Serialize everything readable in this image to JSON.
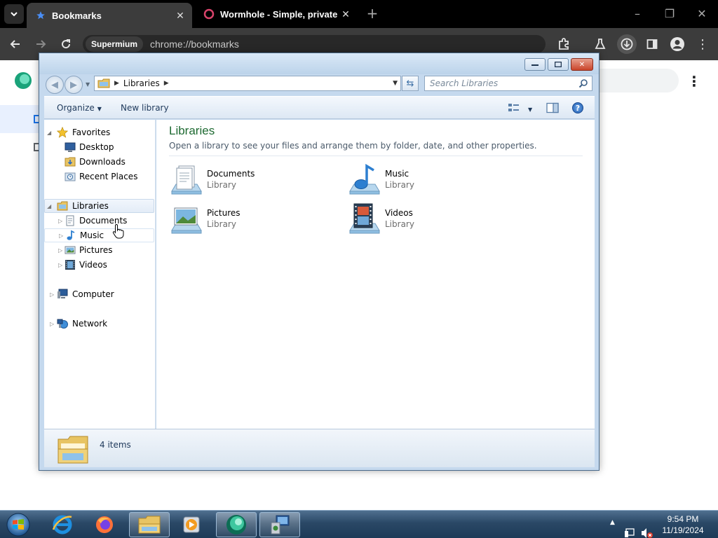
{
  "chrome": {
    "tabs": [
      {
        "title": "Bookmarks",
        "active": true
      },
      {
        "title": "Wormhole - Simple, private file",
        "active": false
      }
    ],
    "omnibox": {
      "chip": "Supermium",
      "url": "chrome://bookmarks"
    }
  },
  "explorer": {
    "address": {
      "crumb": "Libraries"
    },
    "search": {
      "placeholder": "Search Libraries"
    },
    "commands": {
      "organize": "Organize",
      "new_library": "New library"
    },
    "nav": {
      "favorites": "Favorites",
      "desktop": "Desktop",
      "downloads": "Downloads",
      "recent_places": "Recent Places",
      "libraries": "Libraries",
      "documents": "Documents",
      "music": "Music",
      "pictures": "Pictures",
      "videos": "Videos",
      "computer": "Computer",
      "network": "Network"
    },
    "content": {
      "heading": "Libraries",
      "subtitle": "Open a library to see your files and arrange them by folder, date, and other properties.",
      "items": [
        {
          "name": "Documents",
          "type": "Library"
        },
        {
          "name": "Music",
          "type": "Library"
        },
        {
          "name": "Pictures",
          "type": "Library"
        },
        {
          "name": "Videos",
          "type": "Library"
        }
      ]
    },
    "details": {
      "count": "4 items"
    }
  },
  "taskbar": {
    "clock": {
      "time": "9:54 PM",
      "date": "11/19/2024"
    }
  },
  "colors": {
    "heading_green": "#1e6a32",
    "taskbar": "#2a4866",
    "chrome_dark": "#3c3c3c"
  }
}
